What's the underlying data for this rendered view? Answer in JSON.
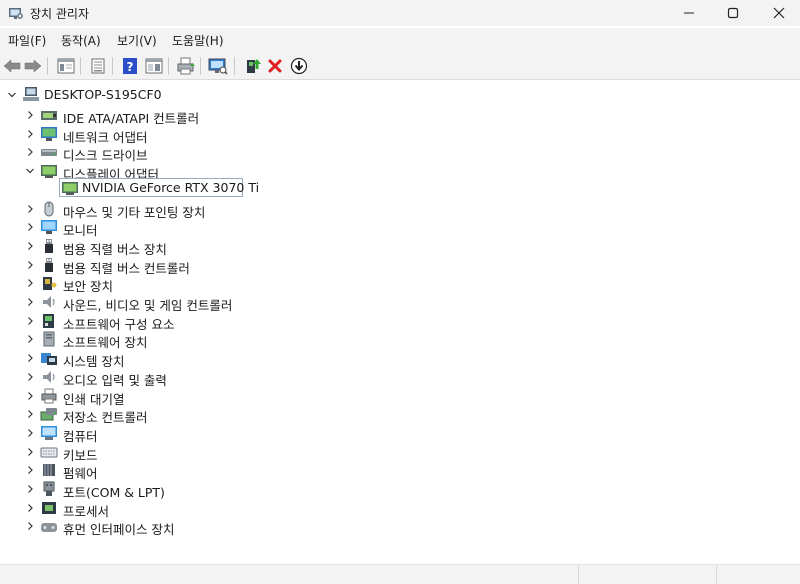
{
  "window": {
    "title": "장치 관리자",
    "controls": [
      "minimize",
      "maximize",
      "close"
    ]
  },
  "menu": [
    {
      "label": "파일(F)"
    },
    {
      "label": "동작(A)"
    },
    {
      "label": "보기(V)"
    },
    {
      "label": "도움말(H)"
    }
  ],
  "toolbar": {
    "buttons": [
      "back-icon",
      "forward-icon",
      "properties-panel-icon",
      "details-icon",
      "help-icon",
      "view-icon",
      "print-icon",
      "scan-hardware-icon",
      "update-driver-icon",
      "uninstall-icon",
      "disable-icon"
    ]
  },
  "tree": {
    "root": "DESKTOP-S195CF0",
    "items": [
      {
        "label": "IDE ATA/ATAPI 컨트롤러",
        "icon": "ide-controller-icon",
        "expanded": false
      },
      {
        "label": "네트워크 어댑터",
        "icon": "network-adapter-icon",
        "expanded": false
      },
      {
        "label": "디스크 드라이브",
        "icon": "disk-drive-icon",
        "expanded": false
      },
      {
        "label": "디스플레이 어댑터",
        "icon": "display-adapter-icon",
        "expanded": true,
        "children": [
          {
            "label": "NVIDIA GeForce RTX 3070 Ti",
            "icon": "gpu-icon",
            "selected": true
          }
        ]
      },
      {
        "label": "마우스 및 기타 포인팅 장치",
        "icon": "mouse-icon",
        "expanded": false
      },
      {
        "label": "모니터",
        "icon": "monitor-icon",
        "expanded": false
      },
      {
        "label": "범용 직렬 버스 장치",
        "icon": "usb-device-icon",
        "expanded": false
      },
      {
        "label": "범용 직렬 버스 컨트롤러",
        "icon": "usb-controller-icon",
        "expanded": false
      },
      {
        "label": "보안 장치",
        "icon": "security-device-icon",
        "expanded": false
      },
      {
        "label": "사운드, 비디오 및 게임 컨트롤러",
        "icon": "sound-icon",
        "expanded": false
      },
      {
        "label": "소프트웨어 구성 요소",
        "icon": "software-component-icon",
        "expanded": false
      },
      {
        "label": "소프트웨어 장치",
        "icon": "software-device-icon",
        "expanded": false
      },
      {
        "label": "시스템 장치",
        "icon": "system-device-icon",
        "expanded": false
      },
      {
        "label": "오디오 입력 및 출력",
        "icon": "audio-io-icon",
        "expanded": false
      },
      {
        "label": "인쇄 대기열",
        "icon": "print-queue-icon",
        "expanded": false
      },
      {
        "label": "저장소 컨트롤러",
        "icon": "storage-controller-icon",
        "expanded": false
      },
      {
        "label": "컴퓨터",
        "icon": "computer-icon",
        "expanded": false
      },
      {
        "label": "키보드",
        "icon": "keyboard-icon",
        "expanded": false
      },
      {
        "label": "펌웨어",
        "icon": "firmware-icon",
        "expanded": false
      },
      {
        "label": "포트(COM & LPT)",
        "icon": "port-icon",
        "expanded": false
      },
      {
        "label": "프로세서",
        "icon": "processor-icon",
        "expanded": false
      },
      {
        "label": "휴먼 인터페이스 장치",
        "icon": "hid-icon",
        "expanded": false
      }
    ]
  },
  "colors": {
    "chrome": "#f3f3f3",
    "selection_border": "#9aa9bb",
    "help_blue": "#2b4fc9",
    "uninstall_red": "#e02020",
    "monitor_blue": "#2f8fd8"
  }
}
